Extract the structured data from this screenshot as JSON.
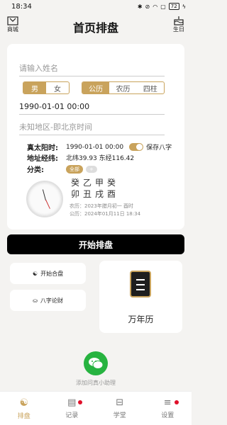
{
  "status": {
    "time": "18:34",
    "battery": "72"
  },
  "header": {
    "title": "首页排盘",
    "left_label": "商城",
    "right_label": "生日"
  },
  "form": {
    "name_placeholder": "请输入姓名",
    "gender": [
      "男",
      "女"
    ],
    "calendar": [
      "公历",
      "农历",
      "四柱"
    ],
    "datetime": "1990-01-01 00:00",
    "location_placeholder": "未知地区-即北京时间"
  },
  "info": {
    "solar_time_label": "真太阳时:",
    "solar_time_value": "1990-01-01 00:00",
    "save_label": "保存八字",
    "coord_label": "地址经纬:",
    "coord_value": "北纬39.93 东经116.42",
    "category_label": "分类:",
    "category_all": "全部",
    "category_add": "+"
  },
  "pillars": {
    "row1": "癸乙甲癸",
    "row2": "卯丑戌酉",
    "lunar": "农历：2023年腊月初一 酉时",
    "solar": "公历：2024年01月11日 18:34"
  },
  "start_button": "开始排盘",
  "cards": {
    "hepan": "开始合盘",
    "bazi": "八字论财",
    "calendar": "万年历"
  },
  "assistant_label": "添加问真小助理",
  "tabs": [
    "排盘",
    "记录",
    "学堂",
    "设置"
  ],
  "colors": {
    "accent": "#c9a35c",
    "primary_button": "#000000",
    "wechat": "#27b340"
  }
}
